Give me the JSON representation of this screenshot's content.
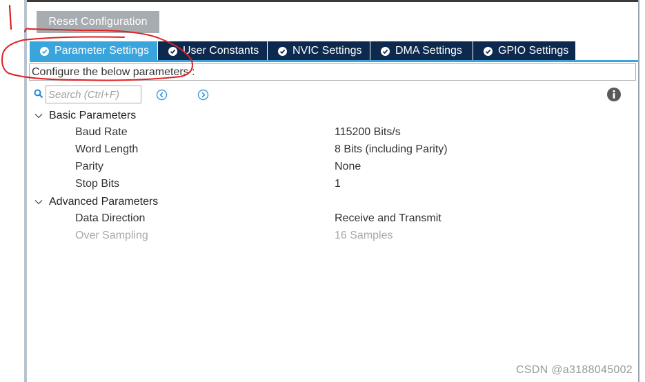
{
  "toolbar": {
    "reset_label": "Reset Configuration"
  },
  "tabs": [
    {
      "label": "Parameter Settings",
      "active": true
    },
    {
      "label": "User Constants",
      "active": false
    },
    {
      "label": "NVIC Settings",
      "active": false
    },
    {
      "label": "DMA Settings",
      "active": false
    },
    {
      "label": "GPIO Settings",
      "active": false
    }
  ],
  "description": "Configure the below parameters :",
  "search": {
    "placeholder": "Search (Ctrl+F)"
  },
  "groups": [
    {
      "label": "Basic Parameters",
      "params": [
        {
          "name": "Baud Rate",
          "value": "115200 Bits/s"
        },
        {
          "name": "Word Length",
          "value": "8 Bits (including Parity)"
        },
        {
          "name": "Parity",
          "value": "None"
        },
        {
          "name": "Stop Bits",
          "value": "1"
        }
      ]
    },
    {
      "label": "Advanced Parameters",
      "params": [
        {
          "name": "Data Direction",
          "value": "Receive and Transmit"
        },
        {
          "name": "Over Sampling",
          "value": "16 Samples"
        }
      ]
    }
  ],
  "watermark": "CSDN @a3188045002",
  "colors": {
    "active_tab": "#3aa4dc",
    "inactive_tab": "#0d2a4e",
    "reset_button": "#a7acb0",
    "annotation": "#e02020",
    "disabled_text": "#a8a8a8"
  }
}
